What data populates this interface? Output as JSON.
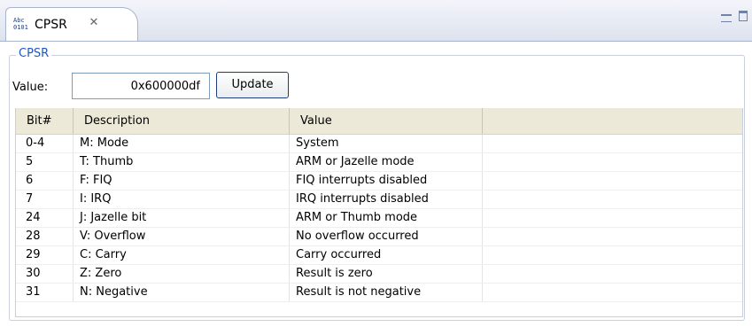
{
  "tab": {
    "icon_text_top": "Abc",
    "icon_text_bottom": "0101",
    "title": "CPSR"
  },
  "group": {
    "legend": "CPSR"
  },
  "value": {
    "label": "Value:",
    "input_value": "0x600000df",
    "update_label": "Update"
  },
  "table": {
    "columns": [
      "Bit#",
      "Description",
      "Value",
      ""
    ],
    "rows": [
      {
        "bit": "0-4",
        "description": "M: Mode",
        "value": "System"
      },
      {
        "bit": "5",
        "description": "T: Thumb",
        "value": "ARM or Jazelle mode"
      },
      {
        "bit": "6",
        "description": "F: FIQ",
        "value": "FIQ interrupts disabled"
      },
      {
        "bit": "7",
        "description": "I: IRQ",
        "value": "IRQ interrupts disabled"
      },
      {
        "bit": "24",
        "description": "J: Jazelle bit",
        "value": "ARM or Thumb mode"
      },
      {
        "bit": "28",
        "description": "V: Overflow",
        "value": "No overflow occurred"
      },
      {
        "bit": "29",
        "description": "C: Carry",
        "value": "Carry occurred"
      },
      {
        "bit": "30",
        "description": "Z: Zero",
        "value": "Result is zero"
      },
      {
        "bit": "31",
        "description": "N: Negative",
        "value": "Result is not negative"
      }
    ]
  },
  "colors": {
    "legend_blue": "#1f58c2",
    "tab_border": "#a7b4c9",
    "header_bg": "#ece9d8"
  }
}
